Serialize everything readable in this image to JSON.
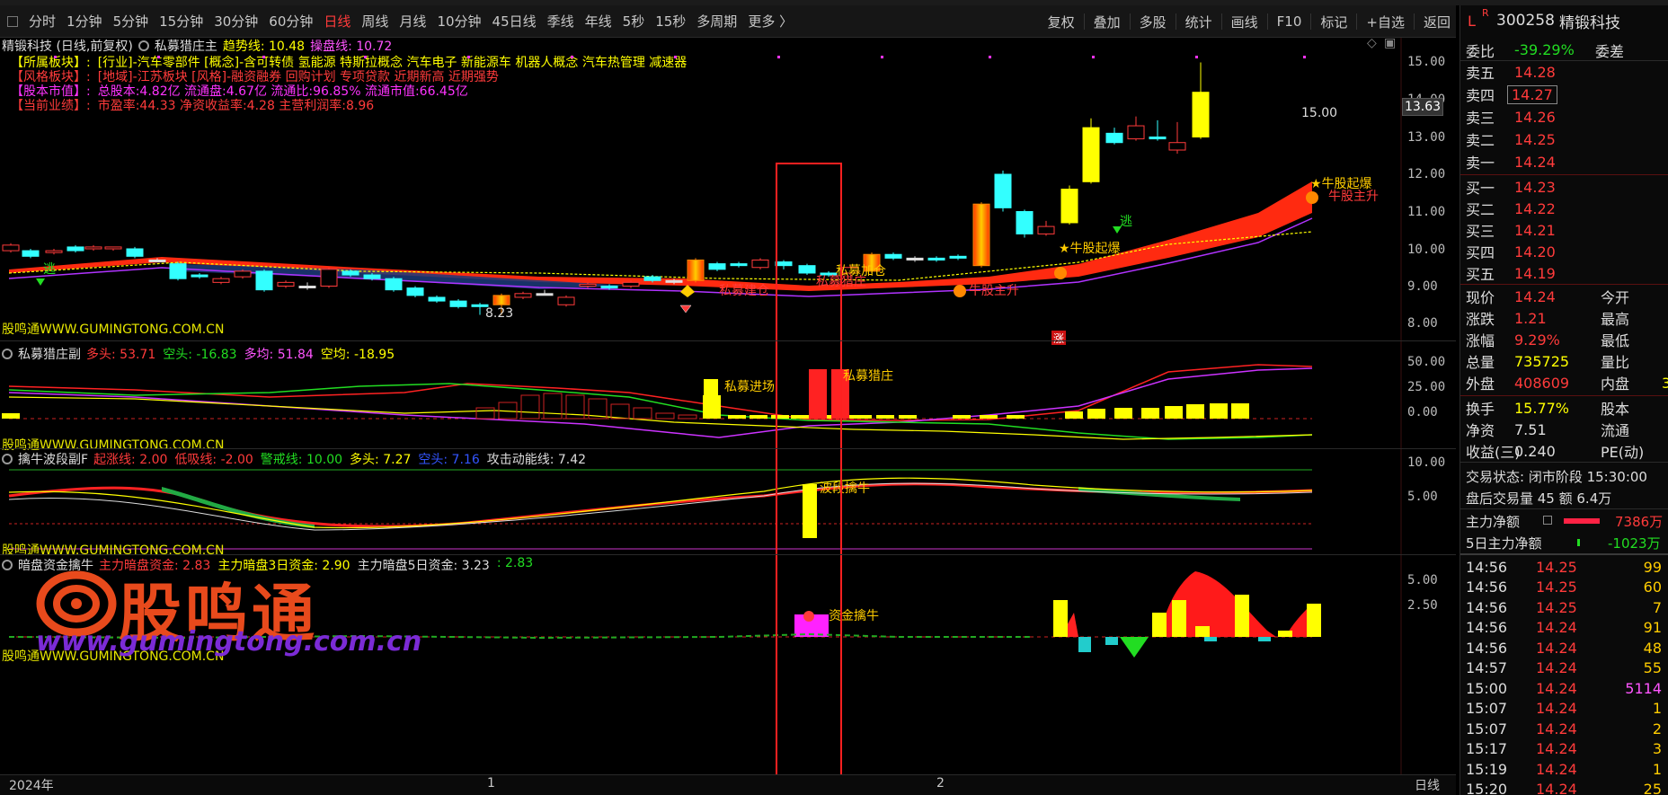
{
  "toolbar": {
    "items": [
      "分时",
      "1分钟",
      "5分钟",
      "15分钟",
      "30分钟",
      "60分钟",
      "日线",
      "周线",
      "月线",
      "10分钟",
      "45日线",
      "季线",
      "年线",
      "5秒",
      "15秒",
      "多周期",
      "更多 〉"
    ],
    "active_index": 6,
    "right_items": [
      "复权",
      "叠加",
      "多股",
      "统计",
      "画线",
      "F10",
      "标记",
      "+自选",
      "返回"
    ]
  },
  "main_panel": {
    "title": "精锻科技 (日线,前复权)",
    "indicator": "私募猎庄主",
    "trend_label": "趋势线: 10.48",
    "control_label": "操盘线: 10.72",
    "info_lines": [
      {
        "tag": "【所属板块】:",
        "text": "[行业]-汽车零部件 [概念]-含可转债 氢能源 特斯拉概念 汽车电子 新能源车 机器人概念 汽车热管理 减速器",
        "color": "#ffff00"
      },
      {
        "tag": "【风格板块】:",
        "text": "[地域]-江苏板块 [风格]-融资融券 回购计划 专项贷款 近期新高 近期强势",
        "color": "#ff3b3b"
      },
      {
        "tag": "【股本市值】:",
        "text": "总股本:4.82亿 流通盘:4.67亿 流通比:96.85% 流通市值:66.45亿",
        "color": "#ff33ff"
      },
      {
        "tag": "【当前业绩】:",
        "text": "市盈率:44.33 净资收益率:4.28 主营利润率:8.96",
        "color": "#ff3b3b"
      }
    ],
    "y_ticks": [
      "15.00",
      "14.00",
      "13.00",
      "12.00",
      "11.00",
      "10.00",
      "9.00",
      "8.00"
    ],
    "price_tag": "13.63",
    "annotations": {
      "high": "15.00",
      "low": "8.23",
      "escape1": "逃",
      "escape2": "逃",
      "bull_start1": "★牛股起爆",
      "bull_start2": "★牛股起爆",
      "bull_rise1": "牛股主升",
      "bull_rise2": "牛股主升",
      "pm_build": "私募建仓",
      "pm_add": "私募加仓",
      "pm_hunt": "私募猎庄",
      "limit_up": "涨"
    },
    "watermark": "股鸣通WWW.GUMINGTONG.COM.CN"
  },
  "panel2": {
    "name": "私募猎庄副",
    "values": [
      {
        "t": "多头: 53.71",
        "c": "#ff3b3b"
      },
      {
        "t": "空头: -16.83",
        "c": "#22dd22"
      },
      {
        "t": "多均: 51.84",
        "c": "#ff55ff"
      },
      {
        "t": "空均: -18.95",
        "c": "#ffff00"
      }
    ],
    "y_ticks": [
      "50.00",
      "25.00",
      "0.00"
    ],
    "annotations": {
      "enter": "私募进场",
      "hunt": "私募猎庄"
    },
    "watermark": "股鸣通WWW.GUMINGTONG.COM.CN"
  },
  "panel3": {
    "name": "擒牛波段副F",
    "values": [
      {
        "t": "起涨线: 2.00",
        "c": "#ff3b3b"
      },
      {
        "t": "低吸线: -2.00",
        "c": "#ff3b3b"
      },
      {
        "t": "警戒线: 10.00",
        "c": "#22dd22"
      },
      {
        "t": "多头: 7.27",
        "c": "#ffff00"
      },
      {
        "t": "空头: 7.16",
        "c": "#3355ff"
      },
      {
        "t": "攻击动能线: 7.42",
        "c": "#dddddd"
      }
    ],
    "y_ticks": [
      "10.00",
      "5.00"
    ],
    "annotations": {
      "catch": "波段擒牛"
    },
    "watermark": "股鸣通WWW.GUMINGTONG.COM.CN"
  },
  "panel4": {
    "name": "暗盘资金擒牛",
    "values": [
      {
        "t": "主力暗盘资金: 2.83",
        "c": "#ff3b3b"
      },
      {
        "t": "主力暗盘3日资金: 2.90",
        "c": "#ffff00"
      },
      {
        "t": "主力暗盘5日资金: 3.23",
        "c": "#dddddd"
      },
      {
        "t": ": 2.83",
        "c": "#22dd22"
      }
    ],
    "y_ticks": [
      "5.00",
      "2.50"
    ],
    "annotations": {
      "catch": "资金擒牛"
    },
    "watermark": "股鸣通WWW.GUMINGTONG.COM.CN"
  },
  "x_axis": {
    "year": "2024年",
    "m1": "1",
    "m2": "2",
    "period": "日线"
  },
  "logo": {
    "name": "股鸣通",
    "url": "www.gumingtong.com.cn"
  },
  "right_panel": {
    "code": "300258",
    "name": "精锻科技",
    "wb_label": "委比",
    "wb_value": "-39.29%",
    "wc_label": "委差",
    "asks": [
      {
        "l": "卖五",
        "p": "14.28"
      },
      {
        "l": "卖四",
        "p": "14.27"
      },
      {
        "l": "卖三",
        "p": "14.26"
      },
      {
        "l": "卖二",
        "p": "14.25"
      },
      {
        "l": "卖一",
        "p": "14.24"
      }
    ],
    "bids": [
      {
        "l": "买一",
        "p": "14.23"
      },
      {
        "l": "买二",
        "p": "14.22"
      },
      {
        "l": "买三",
        "p": "14.21"
      },
      {
        "l": "买四",
        "p": "14.20"
      },
      {
        "l": "买五",
        "p": "14.19"
      }
    ],
    "quote": [
      {
        "l": "现价",
        "v": "14.24",
        "c": "#ff3b3b",
        "l2": "今开"
      },
      {
        "l": "涨跌",
        "v": "1.21",
        "c": "#ff3b3b",
        "l2": "最高"
      },
      {
        "l": "涨幅",
        "v": "9.29%",
        "c": "#ff3b3b",
        "l2": "最低"
      },
      {
        "l": "总量",
        "v": "735725",
        "c": "#ffff00",
        "l2": "量比"
      },
      {
        "l": "外盘",
        "v": "408609",
        "c": "#ff3b3b",
        "l2": "内盘",
        "v2": "3"
      }
    ],
    "quote2": [
      {
        "l": "换手",
        "v": "15.77%",
        "c": "#ffff00",
        "l2": "股本"
      },
      {
        "l": "净资",
        "v": "7.51",
        "c": "#ddd",
        "l2": "流通"
      },
      {
        "l": "收益(三)",
        "v": "0.240",
        "c": "#ddd",
        "l2": "PE(动)"
      }
    ],
    "status": "交易状态: 闭市阶段 15:30:00",
    "after_hours": "盘后交易量 45 额 6.4万",
    "main_net": {
      "l": "主力净额",
      "v": "7386万"
    },
    "main_net5": {
      "l": "5日主力净额",
      "v": "-1023万"
    },
    "ticks": [
      {
        "t": "14:56",
        "p": "14.25",
        "v": "99"
      },
      {
        "t": "14:56",
        "p": "14.25",
        "v": "60"
      },
      {
        "t": "14:56",
        "p": "14.25",
        "v": "7"
      },
      {
        "t": "14:56",
        "p": "14.24",
        "v": "91"
      },
      {
        "t": "14:56",
        "p": "14.24",
        "v": "48"
      },
      {
        "t": "14:57",
        "p": "14.24",
        "v": "55"
      },
      {
        "t": "15:00",
        "p": "14.24",
        "v": "5114"
      },
      {
        "t": "15:07",
        "p": "14.24",
        "v": "1"
      },
      {
        "t": "15:07",
        "p": "14.24",
        "v": "2"
      },
      {
        "t": "15:17",
        "p": "14.24",
        "v": "3"
      },
      {
        "t": "15:19",
        "p": "14.24",
        "v": "1"
      },
      {
        "t": "15:20",
        "p": "14.24",
        "v": "25"
      }
    ]
  }
}
